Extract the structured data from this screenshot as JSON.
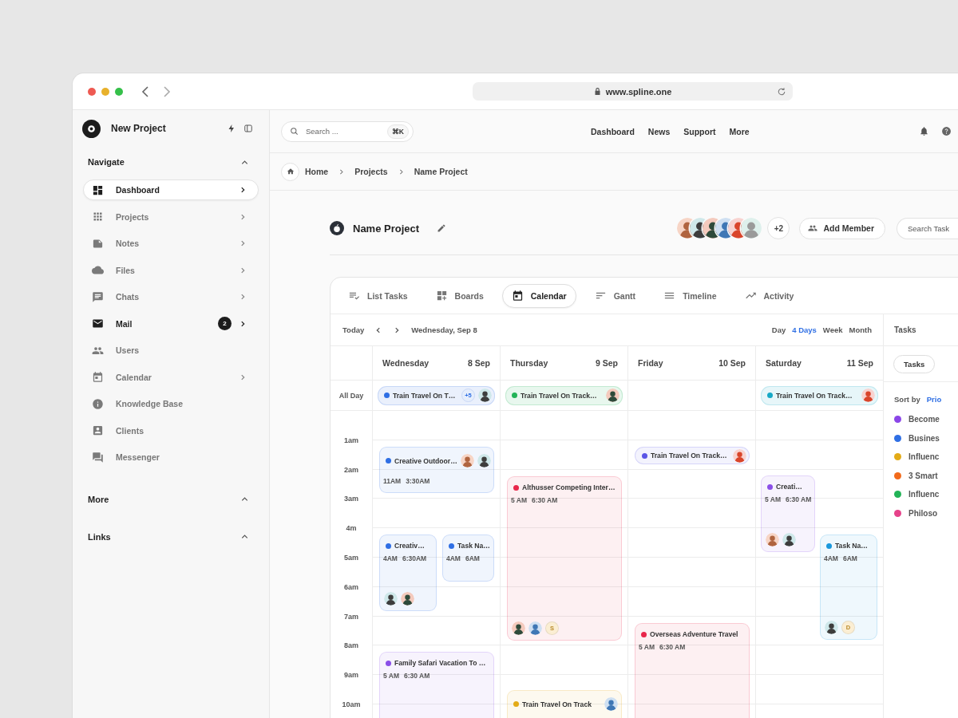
{
  "browser": {
    "url": "www.spline.one"
  },
  "sidebar": {
    "project": "New Project",
    "sections": [
      {
        "title": "Navigate",
        "expanded": true,
        "items": [
          {
            "label": "Dashboard",
            "selected": true,
            "emphasized": true,
            "has_arrow": true
          },
          {
            "label": "Projects",
            "selected": false,
            "emphasized": false,
            "has_arrow": true
          },
          {
            "label": "Notes",
            "selected": false,
            "emphasized": false,
            "has_arrow": true
          },
          {
            "label": "Files",
            "selected": false,
            "emphasized": false,
            "has_arrow": true
          },
          {
            "label": "Chats",
            "selected": false,
            "emphasized": false,
            "has_arrow": true
          },
          {
            "label": "Mail",
            "selected": false,
            "emphasized": true,
            "has_arrow": true,
            "badge": "2"
          },
          {
            "label": "Users",
            "selected": false,
            "emphasized": false,
            "has_arrow": false
          },
          {
            "label": "Calendar",
            "selected": false,
            "emphasized": false,
            "has_arrow": true
          },
          {
            "label": "Knowledge Base",
            "selected": false,
            "emphasized": false,
            "has_arrow": false
          },
          {
            "label": "Clients",
            "selected": false,
            "emphasized": false,
            "has_arrow": false
          },
          {
            "label": "Messenger",
            "selected": false,
            "emphasized": false,
            "has_arrow": false
          }
        ]
      },
      {
        "title": "More",
        "expanded": true
      },
      {
        "title": "Links",
        "expanded": true
      }
    ]
  },
  "top_bar": {
    "search": {
      "placeholder": "Search ...",
      "shortcut": "⌘K"
    },
    "links": [
      "Dashboard",
      "News",
      "Support",
      "More"
    ]
  },
  "breadcrumb": [
    "Home",
    "Projects",
    "Name Project"
  ],
  "project": {
    "title": "Name Project",
    "members": [
      {
        "kind": "picture"
      },
      {
        "kind": "picture"
      },
      {
        "kind": "picture"
      },
      {
        "kind": "picture"
      },
      {
        "kind": "picture"
      },
      {
        "kind": "picture"
      }
    ],
    "more_members": "+2",
    "add_member": "Add Member",
    "search": {
      "placeholder": "Search Task"
    }
  },
  "views": [
    {
      "label": "List Tasks",
      "selected": false
    },
    {
      "label": "Boards",
      "selected": false
    },
    {
      "label": "Calendar",
      "selected": true
    },
    {
      "label": "Gantt",
      "selected": false
    },
    {
      "label": "Timeline",
      "selected": false
    },
    {
      "label": "Activity",
      "selected": false
    }
  ],
  "calendar": {
    "today": "Today",
    "date": "Wednesday, Sep 8",
    "ranges": [
      {
        "label": "Day",
        "selected": false
      },
      {
        "label": "4 Days",
        "selected": true
      },
      {
        "label": "Week",
        "selected": false
      },
      {
        "label": "Month",
        "selected": false
      }
    ],
    "all_day_label": "All Day",
    "hours": [
      "1am",
      "2am",
      "3am",
      "4m",
      "5am",
      "6am",
      "7am",
      "8am",
      "9am",
      "10am"
    ],
    "days": [
      {
        "name": "Wednesday",
        "date": "8 Sep",
        "all_day": {
          "title": "Train Travel On T…",
          "color": "#2f6fe4",
          "extra": "+5",
          "avatars": [
            {
              "kind": "picture"
            }
          ]
        },
        "events": [
          {
            "kind": "inline",
            "title": "Creative Outdoor…",
            "color": "#2f6fe4",
            "times": [
              "11AM",
              "3:30AM"
            ],
            "avatars": [
              {
                "kind": "picture"
              },
              {
                "kind": "picture"
              }
            ]
          },
          {
            "kind": "block",
            "title": "Creativ…",
            "color": "#2f6fe4",
            "times": [
              "4AM",
              "6:30AM"
            ],
            "avatars": [
              {
                "kind": "picture"
              },
              {
                "kind": "picture"
              }
            ]
          },
          {
            "kind": "block",
            "title": "Task Na…",
            "color": "#2f6fe4",
            "times": [
              "4AM",
              "6AM"
            ]
          },
          {
            "kind": "block",
            "title": "Family Safari Vacation To …",
            "color": "#8b4fe8",
            "times": [
              "5 AM",
              "6:30 AM"
            ]
          }
        ]
      },
      {
        "name": "Thursday",
        "date": "9 Sep",
        "all_day": {
          "title": "Train Travel On Track…",
          "color": "#22b357",
          "avatars": [
            {
              "kind": "picture"
            }
          ]
        },
        "events": [
          {
            "kind": "block",
            "title": "Althusser Competing Inter…",
            "color": "#e8264a",
            "times": [
              "5 AM",
              "6:30 AM"
            ],
            "avatars": [
              {
                "kind": "picture"
              },
              {
                "kind": "picture"
              },
              {
                "kind": "initial",
                "label": "S"
              }
            ]
          },
          {
            "kind": "inline",
            "title": "Train Travel On Track",
            "color": "#e3ab17",
            "avatars": [
              {
                "kind": "picture"
              }
            ]
          }
        ]
      },
      {
        "name": "Friday",
        "date": "10 Sep",
        "events": [
          {
            "kind": "pill",
            "title": "Train Travel On Track…",
            "color": "#5b55e6",
            "avatars": [
              {
                "kind": "picture"
              }
            ]
          },
          {
            "kind": "block",
            "title": "Overseas Adventure Travel",
            "color": "#e8264a",
            "times": [
              "5 AM",
              "6:30 AM"
            ]
          }
        ]
      },
      {
        "name": "Saturday",
        "date": "11 Sep",
        "all_day": {
          "title": "Train Travel On Track…",
          "color": "#17a9c6",
          "avatars": [
            {
              "kind": "picture"
            }
          ]
        },
        "events": [
          {
            "kind": "block",
            "title": "Creati…",
            "color": "#8b4fe8",
            "times": [
              "5 AM",
              "6:30 AM"
            ],
            "avatars": [
              {
                "kind": "picture"
              },
              {
                "kind": "picture"
              }
            ]
          },
          {
            "kind": "block",
            "title": "Task Na…",
            "color": "#1a98dc",
            "times": [
              "4AM",
              "6AM"
            ],
            "avatars": [
              {
                "kind": "picture"
              },
              {
                "kind": "initial",
                "label": "D"
              }
            ]
          }
        ]
      }
    ]
  },
  "tasks_panel": {
    "title": "Tasks",
    "tab": "Tasks",
    "sort_label": "Sort by",
    "sort_value": "Prio",
    "items": [
      {
        "label": "Become",
        "color": "#8b46e8"
      },
      {
        "label": "Busines",
        "color": "#2f6fe4"
      },
      {
        "label": "Influenc",
        "color": "#e3ab17"
      },
      {
        "label": "3 Smart",
        "color": "#f26a1b"
      },
      {
        "label": "Influenc",
        "color": "#22b357"
      },
      {
        "label": "Philoso",
        "color": "#e6428a"
      }
    ]
  }
}
